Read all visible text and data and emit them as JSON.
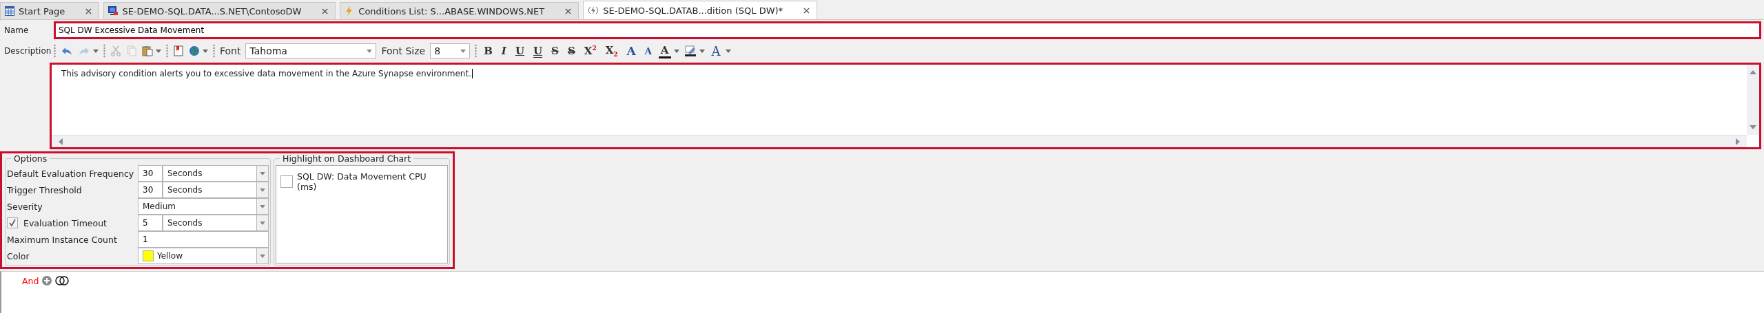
{
  "tabs": [
    {
      "label": "Start Page",
      "kind": "start",
      "selected": false
    },
    {
      "label": "SE-DEMO-SQL.DATA...S.NET\\ContosoDW",
      "kind": "server",
      "selected": false
    },
    {
      "label": "Conditions List: S...ABASE.WINDOWS.NET",
      "kind": "conditions",
      "selected": false
    },
    {
      "label": "SE-DEMO-SQL.DATAB...dition (SQL DW)*",
      "kind": "condition",
      "selected": true
    }
  ],
  "name": {
    "label": "Name",
    "value": "SQL DW Excessive Data Movement"
  },
  "description": {
    "label": "Description",
    "toolbar": {
      "font_label": "Font",
      "font": "Tahoma",
      "size_label": "Font Size",
      "size": "8",
      "format_buttons": [
        {
          "glyph": "B",
          "kind": "bold"
        },
        {
          "glyph": "I",
          "kind": "italic"
        },
        {
          "glyph": "U",
          "kind": "underline"
        },
        {
          "glyph": "U",
          "kind": "double-underline"
        },
        {
          "glyph": "S",
          "kind": "strike"
        },
        {
          "glyph": "S",
          "kind": "double-strike"
        },
        {
          "glyph": "X$^{2}$",
          "kind": "superscript"
        },
        {
          "glyph": "X$_{2}$",
          "kind": "subscript"
        },
        {
          "glyph": "A",
          "kind": "grow"
        },
        {
          "glyph": "A",
          "kind": "shrink"
        },
        {
          "glyph": "A",
          "kind": "font-color"
        },
        {
          "glyph": "A",
          "kind": "style"
        }
      ]
    },
    "text": "This advisory condition alerts you to excessive data movement in the Azure Synapse environment."
  },
  "options": {
    "title": "Options",
    "rows": [
      {
        "kind": "number-unit",
        "label": "Default Evaluation Frequency",
        "value": "30",
        "unit": "Seconds"
      },
      {
        "kind": "number-unit",
        "label": "Trigger Threshold",
        "value": "30",
        "unit": "Seconds"
      },
      {
        "kind": "select",
        "label": "Severity",
        "value": "Medium"
      },
      {
        "kind": "number-unit",
        "label": "Evaluation Timeout",
        "value": "5",
        "unit": "Seconds",
        "checked": true
      },
      {
        "kind": "text",
        "label": "Maximum Instance Count",
        "value": "1"
      },
      {
        "kind": "color",
        "label": "Color",
        "value": "Yellow",
        "color": "#ffff00"
      }
    ]
  },
  "highlight": {
    "title": "Highlight on Dashboard Chart",
    "items": [
      {
        "label": "SQL DW: Data Movement CPU (ms)",
        "checked": false
      }
    ]
  },
  "condition": {
    "operator": "And"
  }
}
